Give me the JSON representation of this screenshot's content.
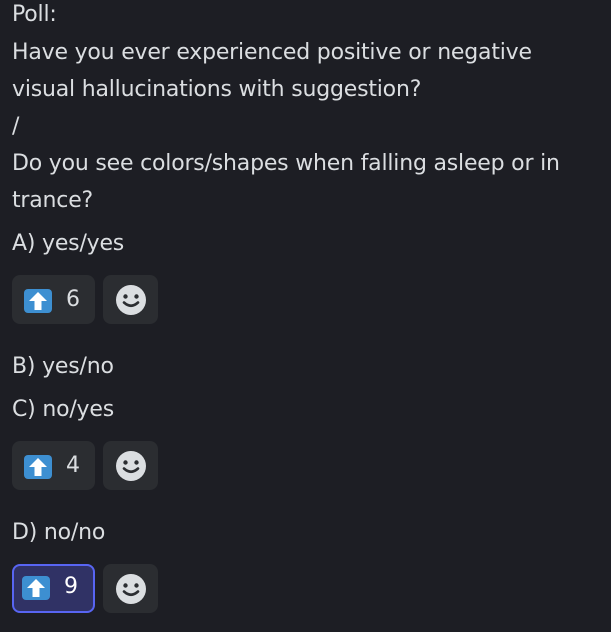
{
  "message": {
    "lines": [
      "Poll:",
      " Have you ever experienced positive or negative",
      "visual hallucinations with suggestion?",
      "/",
      "Do you see colors/shapes when falling asleep or in",
      "trance?",
      "A) yes/yes",
      "B) yes/no",
      "C) no/yes",
      "D) no/no"
    ]
  },
  "reactions": [
    {
      "emoji": "arrow-up-emoji",
      "count": "6",
      "selected": false
    },
    {
      "emoji": "arrow-up-emoji",
      "count": "4",
      "selected": false
    },
    {
      "emoji": "arrow-up-emoji",
      "count": "9",
      "selected": true
    }
  ],
  "add_reaction_icon": "smiley-add-icon"
}
